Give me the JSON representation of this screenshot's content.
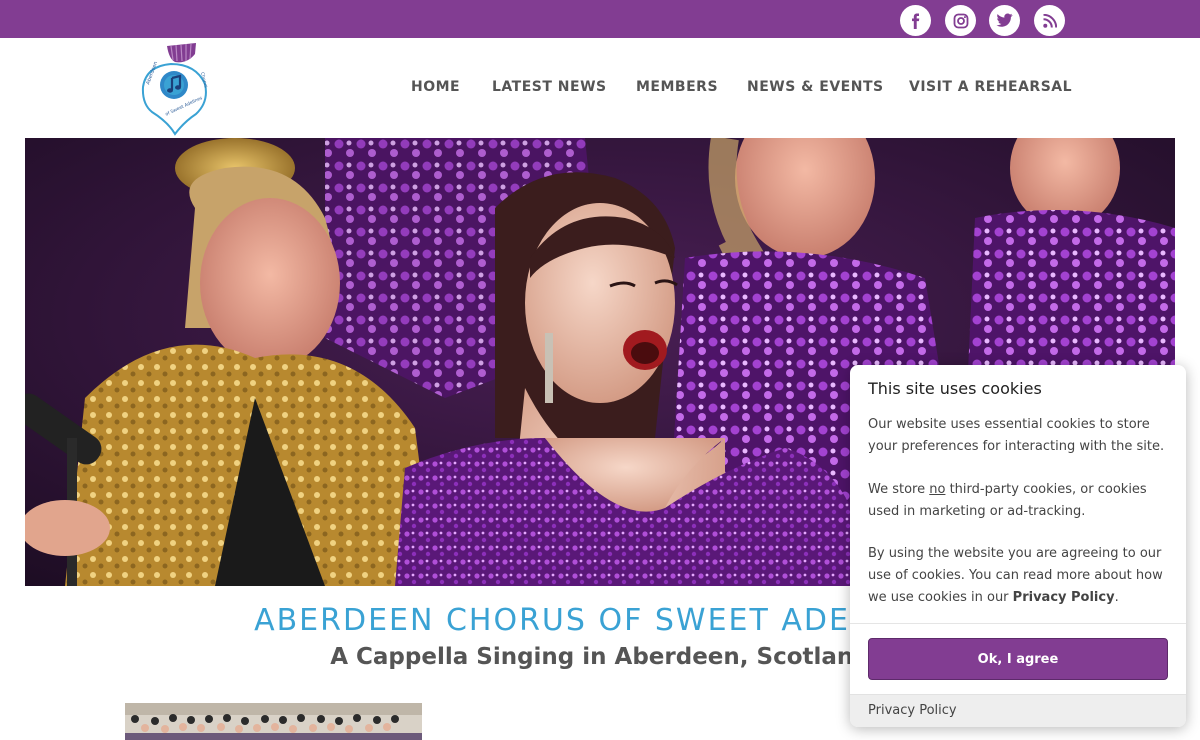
{
  "colors": {
    "brand_purple": "#823d92",
    "accent_blue": "#3aa2d4",
    "text_gray": "#555555"
  },
  "social": [
    {
      "name": "facebook",
      "icon": "facebook-icon"
    },
    {
      "name": "instagram",
      "icon": "instagram-icon"
    },
    {
      "name": "twitter",
      "icon": "twitter-icon"
    },
    {
      "name": "rss",
      "icon": "rss-icon"
    }
  ],
  "logo": {
    "text": "Aberdeen Chorus of Sweet Adelines",
    "icon": "thistle-music-note-logo"
  },
  "nav": {
    "items": [
      {
        "label": "HOME"
      },
      {
        "label": "LATEST NEWS"
      },
      {
        "label": "MEMBERS"
      },
      {
        "label": "NEWS & EVENTS"
      },
      {
        "label": "VISIT A REHEARSAL"
      }
    ]
  },
  "hero": {
    "description_icon": "chorus-singers-photo"
  },
  "main": {
    "title": "ABERDEEN CHORUS OF SWEET ADELINES",
    "subtitle": "A Cappella Singing in Aberdeen, Scotland"
  },
  "cookie_banner": {
    "title": "This site uses cookies",
    "para1": "Our website uses essential cookies to store your preferences for interacting with the site.",
    "para2_pre": "We store ",
    "para2_em": "no",
    "para2_post": " third-party cookies, or cookies used in marketing or ad-tracking.",
    "para3_pre": "By using the website you are agreeing to our use of cookies. You can read more about how we use cookies in our ",
    "para3_link": "Privacy Policy",
    "para3_post": ".",
    "agree_label": "Ok, I agree",
    "footer_link": "Privacy Policy"
  }
}
